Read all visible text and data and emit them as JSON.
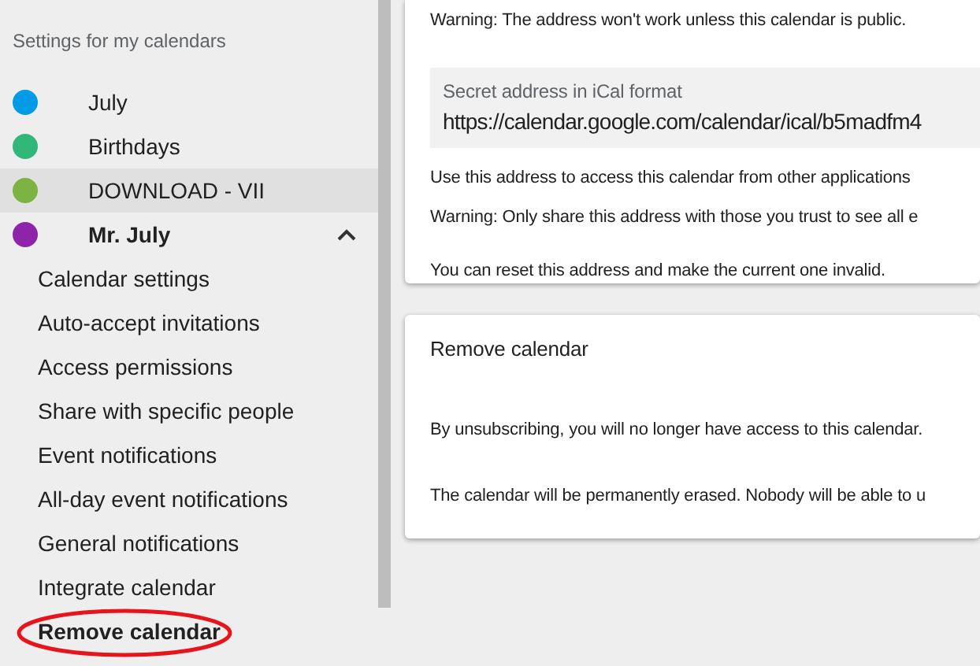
{
  "sidebar": {
    "heading": "Settings for my calendars",
    "calendars": [
      {
        "name": "July",
        "color": "#039be5",
        "selected": false,
        "expanded": false
      },
      {
        "name": "Birthdays",
        "color": "#33b679",
        "selected": false,
        "expanded": false
      },
      {
        "name": "DOWNLOAD - VII",
        "color": "#7cb342",
        "selected": true,
        "expanded": false
      },
      {
        "name": "Mr. July",
        "color": "#8e24aa",
        "selected": false,
        "expanded": true,
        "children": [
          {
            "label": "Calendar settings",
            "circled": false
          },
          {
            "label": "Auto-accept invitations",
            "circled": false
          },
          {
            "label": "Access permissions",
            "circled": false
          },
          {
            "label": "Share with specific people",
            "circled": false
          },
          {
            "label": "Event notifications",
            "circled": false
          },
          {
            "label": "All-day event notifications",
            "circled": false
          },
          {
            "label": "General notifications",
            "circled": false
          },
          {
            "label": "Integrate calendar",
            "circled": false
          },
          {
            "label": "Remove calendar",
            "circled": true
          }
        ]
      }
    ]
  },
  "integrate_card": {
    "warning": "Warning: The address won't work unless this calendar is public.",
    "secret_field": {
      "label": "Secret address in iCal format",
      "value": "https://calendar.google.com/calendar/ical/b5madfm4"
    },
    "notes": [
      "Use this address to access this calendar from other applications",
      "Warning: Only share this address with those you trust to see all e",
      "You can reset this address and make the current one invalid."
    ]
  },
  "remove_card": {
    "title": "Remove calendar",
    "notes": [
      "By unsubscribing, you will no longer have access to this calendar.",
      "The calendar will be permanently erased. Nobody will be able to u"
    ]
  }
}
